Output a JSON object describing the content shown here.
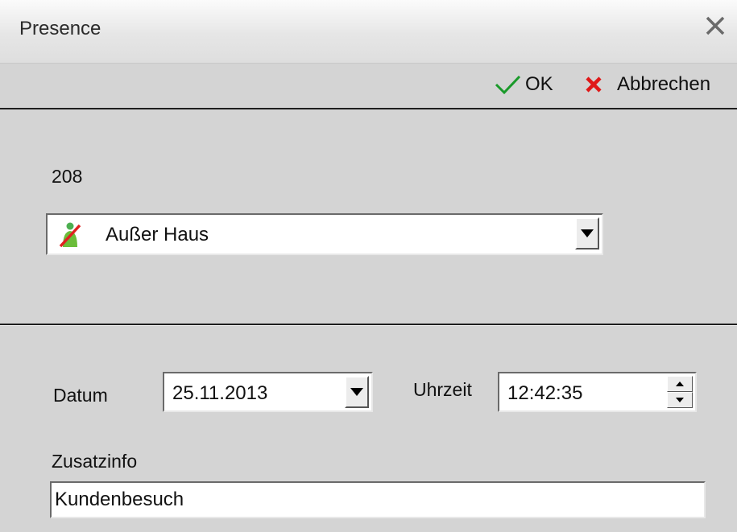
{
  "window": {
    "title": "Presence"
  },
  "toolbar": {
    "ok_label": "OK",
    "cancel_label": "Abbrechen"
  },
  "presence": {
    "number": "208",
    "status": {
      "value": "Außer Haus",
      "icon": "away-person-icon"
    }
  },
  "datum": {
    "label": "Datum",
    "value": "25.11.2013"
  },
  "uhrzeit": {
    "label": "Uhrzeit",
    "value": "12:42:35"
  },
  "zusatzinfo": {
    "label": "Zusatzinfo",
    "value": "Kundenbesuch"
  },
  "colors": {
    "ok_check": "#1a9a2a",
    "cancel_x": "#e01818",
    "window_bg": "#d4d4d4"
  }
}
